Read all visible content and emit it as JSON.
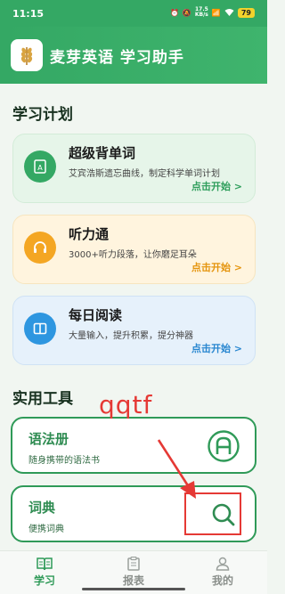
{
  "status_bar": {
    "time": "11:15",
    "net_speed": "17.5",
    "net_unit": "KB/s",
    "battery": "79"
  },
  "app": {
    "title": "麦芽英语 学习助手"
  },
  "plan": {
    "section_title": "学习计划",
    "cards": [
      {
        "title": "超级背单词",
        "desc": "艾宾浩斯遗忘曲线，制定科学单词计划",
        "action": "点击开始 >",
        "icon": "flashcard-icon",
        "color": "#34a864"
      },
      {
        "title": "听力通",
        "desc": "3000+听力段落，让你磨足耳朵",
        "action": "点击开始 >",
        "icon": "headphones-icon",
        "color": "#f4a623"
      },
      {
        "title": "每日阅读",
        "desc": "大量输入，提升积累，提分神器",
        "action": "点击开始 >",
        "icon": "book-icon",
        "color": "#2e96e0"
      }
    ]
  },
  "tools": {
    "section_title": "实用工具",
    "items": [
      {
        "title": "语法册",
        "desc": "随身携带的语法书",
        "icon": "grammar-icon"
      },
      {
        "title": "词典",
        "desc": "便携词典",
        "icon": "search-icon"
      }
    ]
  },
  "annotation": {
    "text": "qqtf",
    "color": "#e53935"
  },
  "bottom_nav": {
    "items": [
      {
        "label": "学习",
        "icon": "study-icon",
        "active": true
      },
      {
        "label": "报表",
        "icon": "report-icon",
        "active": false
      },
      {
        "label": "我的",
        "icon": "profile-icon",
        "active": false
      }
    ]
  }
}
